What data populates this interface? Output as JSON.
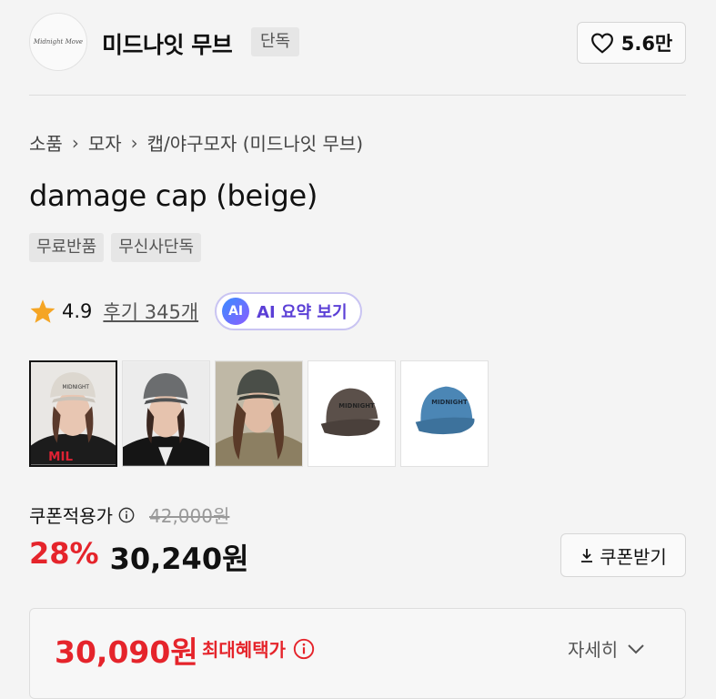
{
  "brand": {
    "logo_text": "Midnight Move",
    "name": "미드나잇 무브",
    "badge": "단독",
    "like_count": "5.6만"
  },
  "breadcrumb": [
    "소품",
    "모자",
    "캡/야구모자 (미드나잇 무브)"
  ],
  "product": {
    "title": "damage cap (beige)",
    "tags": [
      "무료반품",
      "무신사단독"
    ]
  },
  "rating": {
    "score": "4.9",
    "reviews_label": "후기 345개",
    "ai_chip": "AI",
    "ai_label": "AI 요약 보기"
  },
  "thumbnails": [
    {
      "name": "model-beige-cap",
      "cap": "#d9d4cc"
    },
    {
      "name": "model-gray-cap",
      "cap": "#6b6d6f"
    },
    {
      "name": "model-dark-cap",
      "cap": "#4a4e48"
    },
    {
      "name": "cap-brown-product",
      "cap": "#5b504a"
    },
    {
      "name": "cap-blue-product",
      "cap": "#4b86b5"
    }
  ],
  "price": {
    "coupon_label": "쿠폰적용가",
    "original": "42,000원",
    "discount": "28%",
    "final": "30,240원",
    "coupon_button": "쿠폰받기"
  },
  "benefit": {
    "max_price": "30,090원",
    "max_label": "최대혜택가",
    "detail_label": "자세히"
  },
  "colors": {
    "accent_red": "#e5242b",
    "ai_purple": "#5b3fd6"
  }
}
